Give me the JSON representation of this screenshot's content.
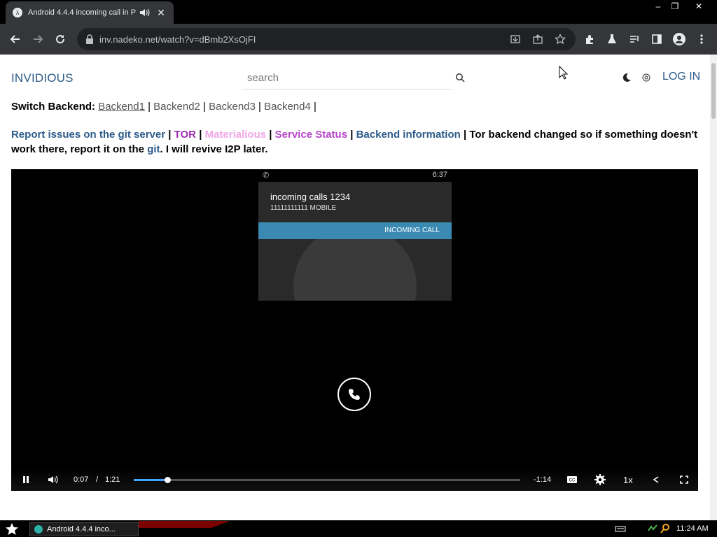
{
  "browser": {
    "tab_title": "Android 4.4.4 incoming call in P",
    "url": "inv.nadeko.net/watch?v=dBmb2XsOjFI"
  },
  "window_controls": {
    "minimize": "–",
    "restore": "❐",
    "close": "✕",
    "tab_close": "✕"
  },
  "header": {
    "brand": "INVIDIOUS",
    "search_placeholder": "search",
    "login_label": "LOG IN"
  },
  "backend": {
    "label": "Switch Backend:",
    "items": [
      "Backend1",
      "Backend2",
      "Backend3",
      "Backend4"
    ],
    "separator": "|"
  },
  "info": {
    "report": "Report issues on the git server",
    "tor": "TOR",
    "materialious": "Materialious",
    "status": "Service Status",
    "backend_info": "Backend information",
    "note_part1": " | Tor backend changed so if something doesn't work there, report it on the ",
    "git": "git",
    "note_part2": ". I will revive I2P later.",
    "sep": " | "
  },
  "video": {
    "phone_time": "6:37",
    "caller_name": "incoming calls 1234",
    "caller_number": "11111111111  MOBILE",
    "incoming_label": "INCOMING CALL",
    "current_time": "0:07",
    "time_sep": "/",
    "duration": "1:21",
    "remaining": "-1:14",
    "speed": "1x",
    "progress_fraction": 0.087
  },
  "taskbar": {
    "task_label": "Android 4.4.4 inco...",
    "clock": "11:24 AM"
  },
  "colors": {
    "brand": "#2c5b8a",
    "progress": "#3ea6ff",
    "tor": "#9b2fae",
    "materialious": "#f0a6e8"
  }
}
